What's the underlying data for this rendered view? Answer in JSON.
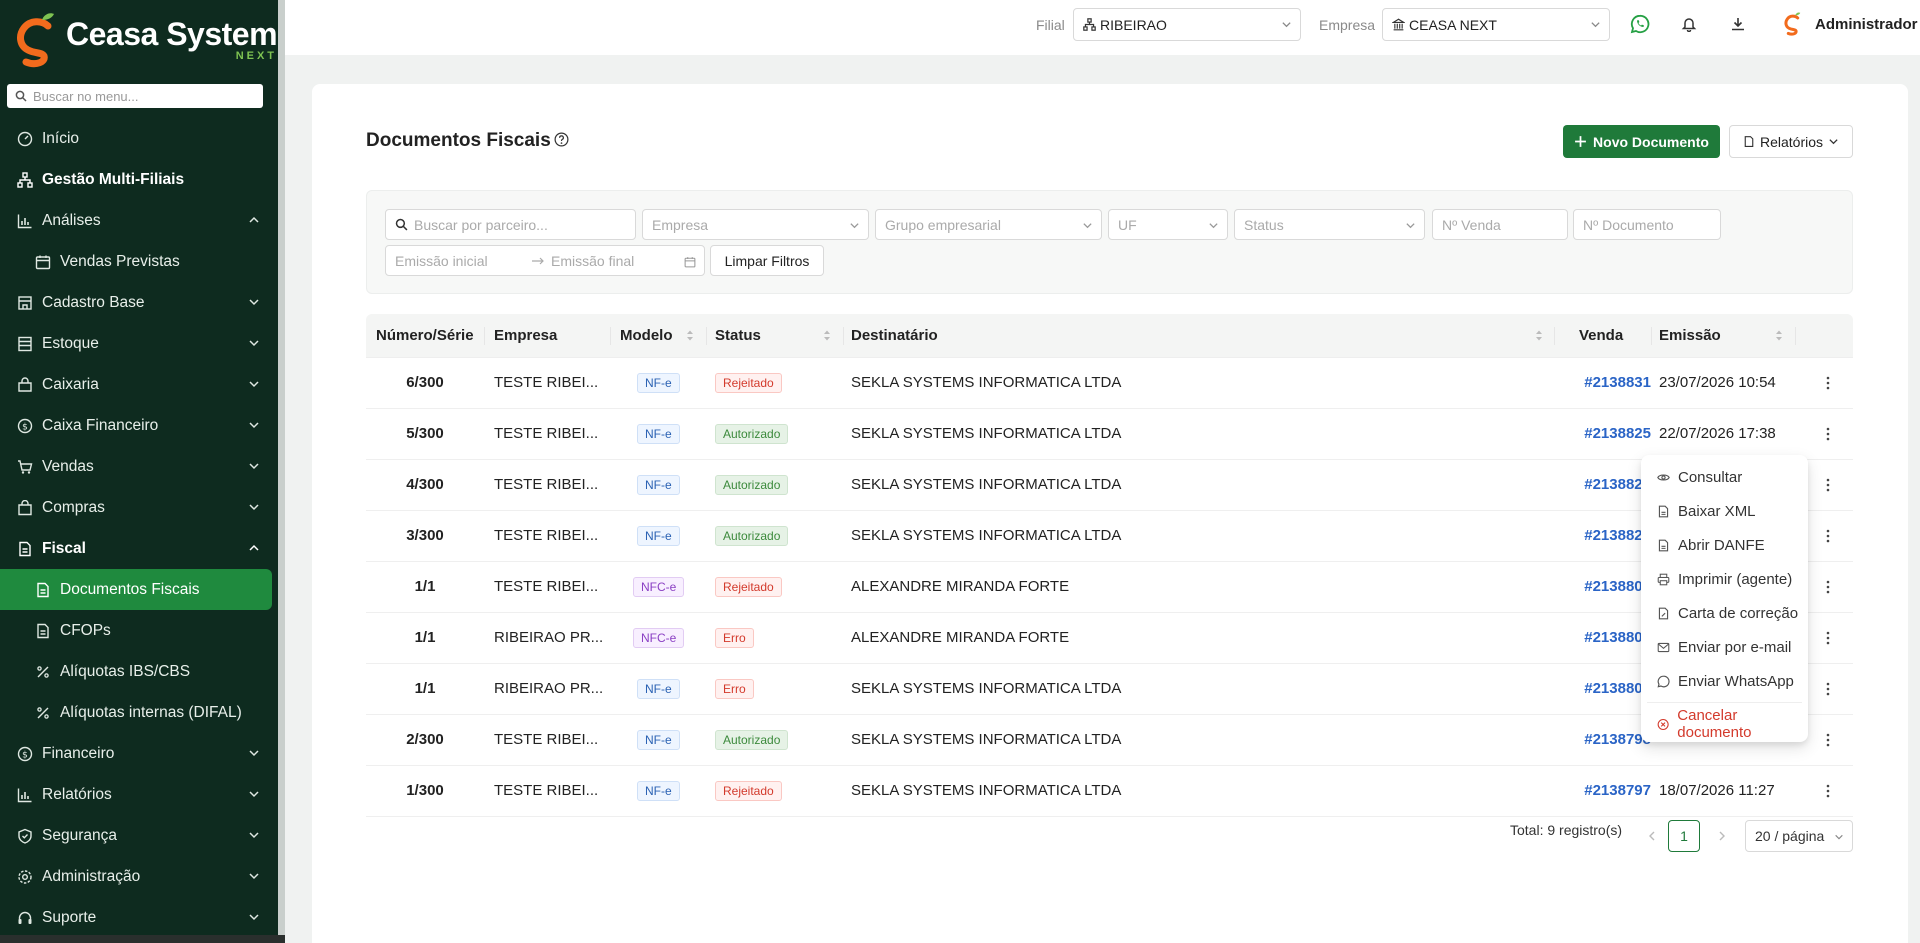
{
  "brand": {
    "name": "Ceasa System",
    "tagline": "NEXT"
  },
  "sidebar": {
    "search_placeholder": "Buscar no menu...",
    "items": [
      {
        "label": "Início",
        "icon": "dashboard-icon"
      },
      {
        "label": "Gestão Multi-Filiais",
        "icon": "network-icon"
      },
      {
        "label": "Análises",
        "icon": "bar-chart-icon"
      },
      {
        "label": "Vendas Previstas",
        "icon": "calendar-icon"
      },
      {
        "label": "Cadastro Base",
        "icon": "building-icon"
      },
      {
        "label": "Estoque",
        "icon": "stock-icon"
      },
      {
        "label": "Caixaria",
        "icon": "box-icon"
      },
      {
        "label": "Caixa Financeiro",
        "icon": "dollar-icon"
      },
      {
        "label": "Vendas",
        "icon": "cart-icon"
      },
      {
        "label": "Compras",
        "icon": "bag-icon"
      },
      {
        "label": "Fiscal",
        "icon": "file-icon"
      },
      {
        "label": "Documentos Fiscais",
        "icon": "file-icon"
      },
      {
        "label": "CFOPs",
        "icon": "file-icon"
      },
      {
        "label": "Alíquotas IBS/CBS",
        "icon": "percent-icon"
      },
      {
        "label": "Alíquotas internas (DIFAL)",
        "icon": "percent-icon"
      },
      {
        "label": "Financeiro",
        "icon": "dollar-icon"
      },
      {
        "label": "Relatórios",
        "icon": "bar-chart-icon"
      },
      {
        "label": "Segurança",
        "icon": "shield-icon"
      },
      {
        "label": "Administração",
        "icon": "gear-icon"
      },
      {
        "label": "Suporte",
        "icon": "headset-icon"
      }
    ]
  },
  "header": {
    "filial_label": "Filial",
    "filial_value": "RIBEIRAO",
    "empresa_label": "Empresa",
    "empresa_value": "CEASA NEXT",
    "user_name": "Administrador"
  },
  "page": {
    "title": "Documentos Fiscais",
    "new_button": "Novo Documento",
    "reports_button": "Relatórios"
  },
  "filters": {
    "parceiro_placeholder": "Buscar por parceiro...",
    "empresa_placeholder": "Empresa",
    "grupo_placeholder": "Grupo empresarial",
    "uf_placeholder": "UF",
    "status_placeholder": "Status",
    "venda_placeholder": "Nº Venda",
    "documento_placeholder": "Nº Documento",
    "emissao_inicial_placeholder": "Emissão inicial",
    "emissao_final_placeholder": "Emissão final",
    "clear_button": "Limpar Filtros"
  },
  "table": {
    "columns": [
      "Número/Série",
      "Empresa",
      "Modelo",
      "Status",
      "Destinatário",
      "Venda",
      "Emissão"
    ],
    "rows": [
      {
        "numero": "6/300",
        "empresa": "TESTE RIBEI...",
        "modelo": "NF-e",
        "status": "Rejeitado",
        "destinatario": "SEKLA SYSTEMS INFORMATICA LTDA",
        "venda": "#2138831",
        "emissao": "23/07/2026 10:54"
      },
      {
        "numero": "5/300",
        "empresa": "TESTE RIBEI...",
        "modelo": "NF-e",
        "status": "Autorizado",
        "destinatario": "SEKLA SYSTEMS INFORMATICA LTDA",
        "venda": "#2138825",
        "emissao": "22/07/2026 17:38"
      },
      {
        "numero": "4/300",
        "empresa": "TESTE RIBEI...",
        "modelo": "NF-e",
        "status": "Autorizado",
        "destinatario": "SEKLA SYSTEMS INFORMATICA LTDA",
        "venda": "#2138821",
        "emissao": ""
      },
      {
        "numero": "3/300",
        "empresa": "TESTE RIBEI...",
        "modelo": "NF-e",
        "status": "Autorizado",
        "destinatario": "SEKLA SYSTEMS INFORMATICA LTDA",
        "venda": "#2138820",
        "emissao": ""
      },
      {
        "numero": "1/1",
        "empresa": "TESTE RIBEI...",
        "modelo": "NFC-e",
        "status": "Rejeitado",
        "destinatario": "ALEXANDRE MIRANDA FORTE",
        "venda": "#2138806",
        "emissao": ""
      },
      {
        "numero": "1/1",
        "empresa": "RIBEIRAO PR...",
        "modelo": "NFC-e",
        "status": "Erro",
        "destinatario": "ALEXANDRE MIRANDA FORTE",
        "venda": "#2138805",
        "emissao": ""
      },
      {
        "numero": "1/1",
        "empresa": "RIBEIRAO PR...",
        "modelo": "NF-e",
        "status": "Erro",
        "destinatario": "SEKLA SYSTEMS INFORMATICA LTDA",
        "venda": "#2138802",
        "emissao": ""
      },
      {
        "numero": "2/300",
        "empresa": "TESTE RIBEI...",
        "modelo": "NF-e",
        "status": "Autorizado",
        "destinatario": "SEKLA SYSTEMS INFORMATICA LTDA",
        "venda": "#2138798",
        "emissao": ""
      },
      {
        "numero": "1/300",
        "empresa": "TESTE RIBEI...",
        "modelo": "NF-e",
        "status": "Rejeitado",
        "destinatario": "SEKLA SYSTEMS INFORMATICA LTDA",
        "venda": "#2138797",
        "emissao": "18/07/2026 11:27"
      }
    ]
  },
  "pagination": {
    "total_text": "Total: 9 registro(s)",
    "current_page": "1",
    "page_size": "20 / página"
  },
  "row_menu": {
    "items": [
      {
        "label": "Consultar",
        "icon": "eye-icon"
      },
      {
        "label": "Baixar XML",
        "icon": "file-icon"
      },
      {
        "label": "Abrir DANFE",
        "icon": "file-icon"
      },
      {
        "label": "Imprimir (agente)",
        "icon": "printer-icon"
      },
      {
        "label": "Carta de correção",
        "icon": "file-edit-icon"
      },
      {
        "label": "Enviar por e-mail",
        "icon": "mail-icon"
      },
      {
        "label": "Enviar WhatsApp",
        "icon": "whatsapp-icon"
      }
    ],
    "danger_item": {
      "label": "Cancelar documento",
      "icon": "close-circle-icon"
    }
  },
  "colors": {
    "sidebar_bg": "#0e2b1f",
    "accent": "#1f7a3a",
    "active_item": "#1f8a3e",
    "link": "#2a64c6",
    "danger": "#d33a2c",
    "brand_orange": "#f26b1d",
    "brand_green": "#7ec352"
  }
}
